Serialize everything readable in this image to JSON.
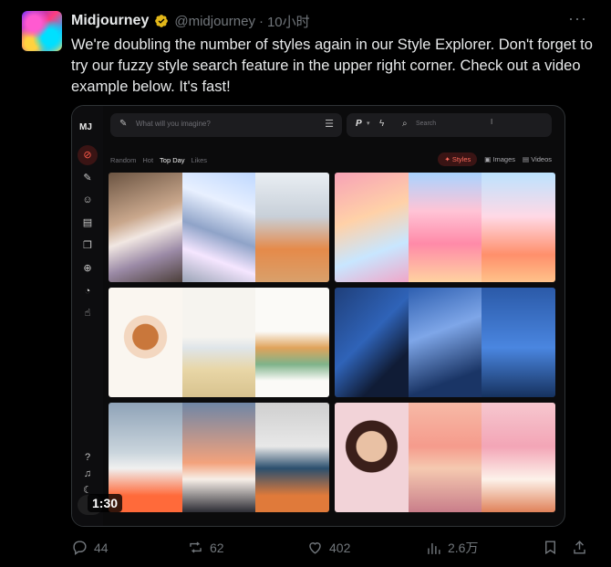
{
  "tweet": {
    "display_name": "Midjourney",
    "handle": "@midjourney",
    "separator": "·",
    "time": "10小时",
    "more_label": "···",
    "text": "We're doubling the number of styles again in our Style Explorer. Don't forget to try our fuzzy style search feature in the upper right corner.  Check out a video example below. It's fast!",
    "video_duration": "1:30"
  },
  "app": {
    "logo": "MJ",
    "prompt_placeholder": "What will you imagine?",
    "search_placeholder": "Search",
    "personalize_label": "P",
    "feed_tabs": [
      {
        "label": "Random",
        "active": false
      },
      {
        "label": "Hot",
        "active": false
      },
      {
        "label": "Top Day",
        "active": true
      },
      {
        "label": "Likes",
        "active": false
      }
    ],
    "filters": [
      {
        "label": "Styles",
        "selected": true,
        "icon": "sparkle-icon"
      },
      {
        "label": "Images",
        "selected": false,
        "icon": "image-icon"
      },
      {
        "label": "Videos",
        "selected": false,
        "icon": "video-icon"
      }
    ],
    "sidebar_icons": [
      "compass-icon",
      "brush-icon",
      "smile-icon",
      "folder-icon",
      "copy-icon",
      "globe-icon",
      "chat-icon",
      "thumbs-up-icon"
    ],
    "sidebar_bottom_icons": [
      "help-icon",
      "bell-icon",
      "moon-icon"
    ]
  },
  "stats": {
    "replies": "44",
    "reposts": "62",
    "likes": "402",
    "views": "2.6万"
  },
  "colors": {
    "background": "#000000",
    "text_primary": "#e7e9ea",
    "text_secondary": "#71767b",
    "verified_gold": "#e2b719",
    "app_accent": "#ff5a4a"
  }
}
